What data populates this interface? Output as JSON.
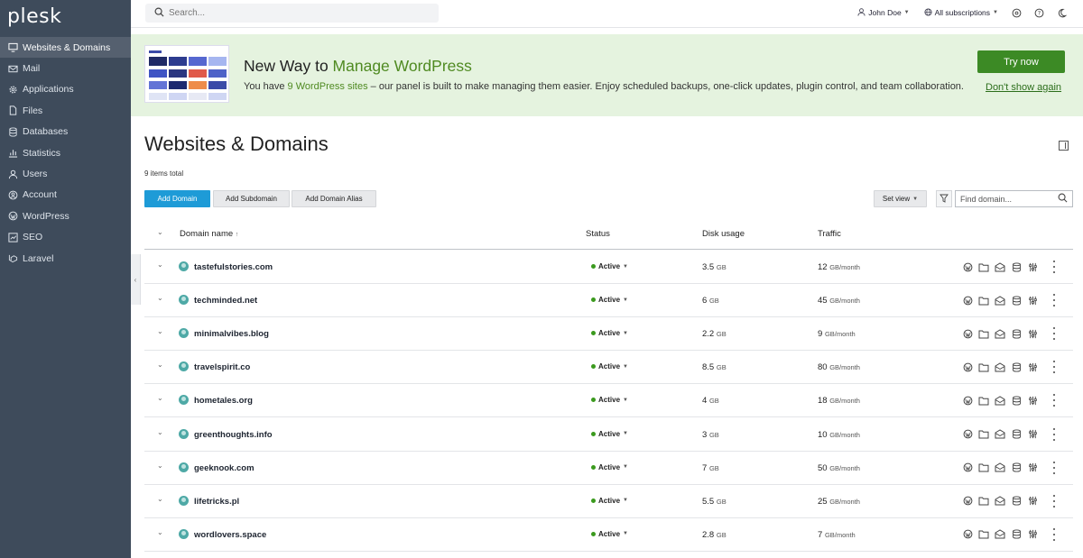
{
  "app": {
    "logo": "plesk"
  },
  "sidebar": {
    "items": [
      {
        "label": "Websites & Domains",
        "icon": "monitor-icon",
        "active": true
      },
      {
        "label": "Mail",
        "icon": "mail-icon"
      },
      {
        "label": "Applications",
        "icon": "gear-icon"
      },
      {
        "label": "Files",
        "icon": "file-icon"
      },
      {
        "label": "Databases",
        "icon": "database-icon"
      },
      {
        "label": "Statistics",
        "icon": "chart-icon"
      },
      {
        "label": "Users",
        "icon": "user-icon"
      },
      {
        "label": "Account",
        "icon": "account-icon"
      },
      {
        "label": "WordPress",
        "icon": "wordpress-icon"
      },
      {
        "label": "SEO",
        "icon": "seo-icon"
      },
      {
        "label": "Laravel",
        "icon": "laravel-icon"
      }
    ]
  },
  "topbar": {
    "search_placeholder": "Search...",
    "user": "John Doe",
    "subscriptions": "All subscriptions"
  },
  "banner": {
    "title_prefix": "New Way to ",
    "title_highlight": "Manage WordPress",
    "text_prefix": "You have ",
    "text_highlight": "9 WordPress sites",
    "text_suffix": " – our panel is built to make managing them easier. Enjoy scheduled backups, one-click updates, plugin control, and team collaboration.",
    "try_label": "Try now",
    "dismiss_label": "Don't show again"
  },
  "page": {
    "title": "Websites & Domains",
    "items_total": "9 items total"
  },
  "toolbar": {
    "add_domain": "Add Domain",
    "add_subdomain": "Add Subdomain",
    "add_alias": "Add Domain Alias",
    "set_view": "Set view",
    "find_placeholder": "Find domain..."
  },
  "table": {
    "columns": {
      "domain": "Domain name",
      "status": "Status",
      "disk": "Disk usage",
      "traffic": "Traffic"
    },
    "disk_unit": "GB",
    "traffic_unit": "GB/month",
    "rows": [
      {
        "domain": "tastefulstories.com",
        "status": "Active",
        "disk": "3.5",
        "traffic": "12"
      },
      {
        "domain": "techminded.net",
        "status": "Active",
        "disk": "6",
        "traffic": "45"
      },
      {
        "domain": "minimalvibes.blog",
        "status": "Active",
        "disk": "2.2",
        "traffic": "9"
      },
      {
        "domain": "travelspirit.co",
        "status": "Active",
        "disk": "8.5",
        "traffic": "80"
      },
      {
        "domain": "hometales.org",
        "status": "Active",
        "disk": "4",
        "traffic": "18"
      },
      {
        "domain": "greenthoughts.info",
        "status": "Active",
        "disk": "3",
        "traffic": "10"
      },
      {
        "domain": "geeknook.com",
        "status": "Active",
        "disk": "7",
        "traffic": "50"
      },
      {
        "domain": "lifetricks.pl",
        "status": "Active",
        "disk": "5.5",
        "traffic": "25"
      },
      {
        "domain": "wordlovers.space",
        "status": "Active",
        "disk": "2.8",
        "traffic": "7"
      }
    ]
  },
  "colors": {
    "sidebar": "#3e4b5b",
    "accent": "#1e9bd7",
    "brand_green": "#3c8a25",
    "status_active": "#3b9a1e"
  }
}
